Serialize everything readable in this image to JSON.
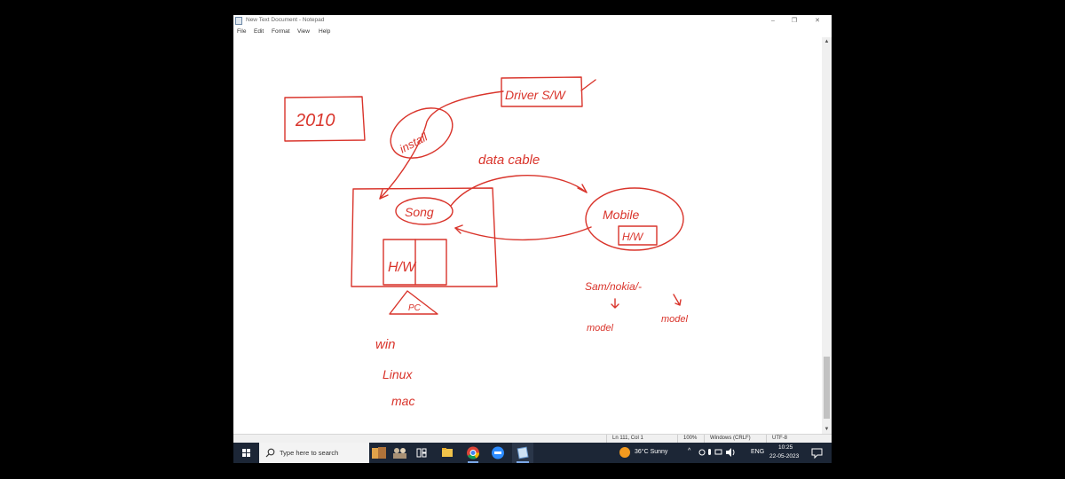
{
  "window": {
    "title": "New Text Document - Notepad",
    "controls": [
      "–",
      "❐",
      "✕"
    ]
  },
  "menu": [
    "File",
    "Edit",
    "Format",
    "View",
    "Help"
  ],
  "drawing": {
    "year_box": "2010",
    "driver_box": "Driver S/W",
    "install_bubble": "install",
    "data_cable_label": "data cable",
    "song_bubble": "Song",
    "pc_hw_box": "H/W",
    "pc_label": "PC",
    "mobile_bubble": "Mobile",
    "mobile_hw": "H/W",
    "brand_model": "Sam/nokia/-",
    "model_left": "model",
    "model_right": "model",
    "os_list": [
      "win",
      "Linux",
      "mac"
    ]
  },
  "status": {
    "position": "Ln 111, Col 1",
    "zoom": "100%",
    "line_ending": "Windows (CRLF)",
    "encoding": "UTF-8"
  },
  "taskbar": {
    "search_placeholder": "Type here to search",
    "weather": "36°C  Sunny",
    "language": "ENG",
    "time": "10:25",
    "date": "22-05-2023"
  },
  "colors": {
    "ink": "#d9342b",
    "taskbar": "#1c2636"
  }
}
